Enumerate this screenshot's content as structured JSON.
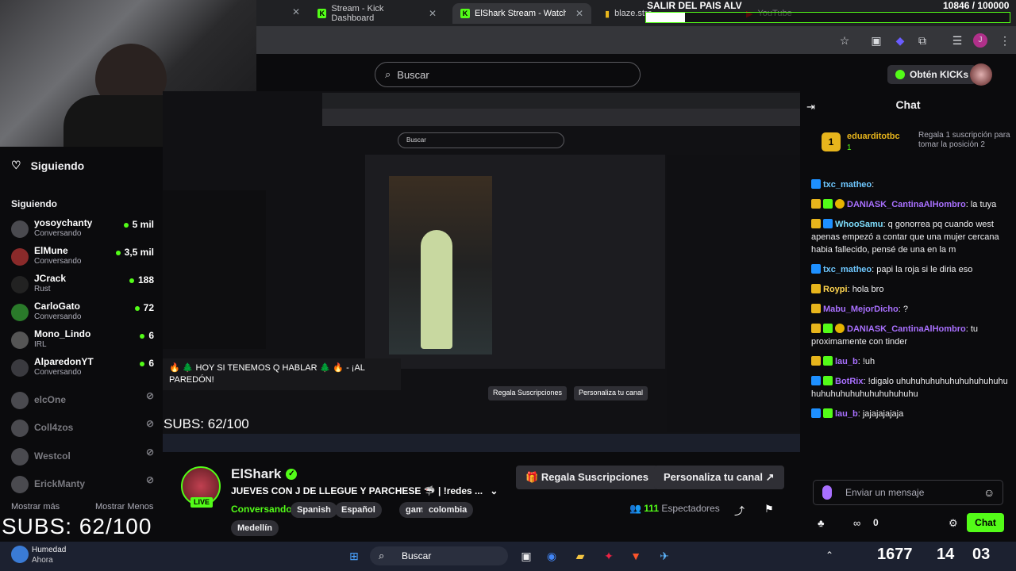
{
  "browser": {
    "tabs": [
      {
        "label": "Stream - Kick Dashboard",
        "active": false
      },
      {
        "label": "ElShark Stream - Watch Live",
        "active": true
      },
      {
        "label": "blaze.stream/blaze",
        "active": false
      },
      {
        "label": "YouTube",
        "active": false
      }
    ]
  },
  "overlay": {
    "goal_title": "SALIR DEL PAIS ALV",
    "goal_count": "10846 / 100000",
    "goal_fraction": 0.108,
    "subs_goal": "SUBS: 62/100"
  },
  "notification": {
    "text": "🔥 🌲 HOY SI TENEMOS Q HABLAR 🌲 🔥 - ¡AL PAREDÓN!"
  },
  "header": {
    "search_placeholder": "Buscar",
    "kicks_button": "Obtén KICKs"
  },
  "sidebar": {
    "section_title": "Siguiendo",
    "subheading": "Siguiendo",
    "channels": [
      {
        "name": "yosoychanty",
        "category": "Conversando",
        "viewers": "5 mil",
        "live": true
      },
      {
        "name": "ElMune",
        "category": "Conversando",
        "viewers": "3,5 mil",
        "live": true
      },
      {
        "name": "JCrack",
        "category": "Rust",
        "viewers": "188",
        "live": true
      },
      {
        "name": "CarloGato",
        "category": "Conversando",
        "viewers": "72",
        "live": true
      },
      {
        "name": "Mono_Lindo",
        "category": "IRL",
        "viewers": "6",
        "live": true
      },
      {
        "name": "AlparedonYT",
        "category": "Conversando",
        "viewers": "6",
        "live": true
      },
      {
        "name": "elcOne",
        "category": "",
        "viewers": "",
        "live": false
      },
      {
        "name": "Coll4zos",
        "category": "",
        "viewers": "",
        "live": false
      },
      {
        "name": "Westcol",
        "category": "",
        "viewers": "",
        "live": false
      },
      {
        "name": "ErickManty",
        "category": "",
        "viewers": "",
        "live": false
      }
    ],
    "show_more": "Mostrar más",
    "show_less": "Mostrar Menos"
  },
  "stream": {
    "streamer": "ElShark",
    "live_label": "LIVE",
    "title": "JUEVES CON J DE LLEGUE Y PARCHESE 🦈 | !redes ...",
    "category": "Conversando",
    "tags": [
      "Spanish",
      "Español",
      "gaming",
      "colombia",
      "Medellín"
    ],
    "gift_button": "Regala Suscripciones",
    "customize_button": "Personaliza tu canal",
    "viewers_count": "111",
    "viewers_label": "Espectadores"
  },
  "chat": {
    "title": "Chat",
    "pinned": {
      "rank": "1",
      "user": "eduarditotbc",
      "level": "1",
      "text": "Regala 1 suscripción para tomar la posición 2"
    },
    "messages": [
      {
        "user": "txc_matheo",
        "color": "u-blue",
        "text": ""
      },
      {
        "user": "DANIASK_CantinaAlHombro",
        "color": "u-purple",
        "text": "la tuya"
      },
      {
        "user": "WhooSamu",
        "color": "u-teal",
        "text": "q gonorrea pq cuando west apenas empezó a contar que una mujer cercana habia fallecido, pensé de una en la m"
      },
      {
        "user": "txc_matheo",
        "color": "u-blue",
        "text": "papi la roja si le diria eso"
      },
      {
        "user": "Roypi",
        "color": "u-yellow",
        "text": "hola bro"
      },
      {
        "user": "Mabu_MejorDicho",
        "color": "u-purple",
        "text": "?"
      },
      {
        "user": "DANIASK_CantinaAlHombro",
        "color": "u-purple",
        "text": "tu proximamente con tinder"
      },
      {
        "user": "lau_b",
        "color": "u-purple",
        "text": "!uh"
      },
      {
        "user": "BotRix",
        "color": "u-purple",
        "text": "!digalo uhuhuhuhuhuhuhuhuhuhuhuhuhuhuhuhuhuhuhuhuhuhu"
      },
      {
        "user": "lau_b",
        "color": "u-purple",
        "text": "jajajajajaja"
      }
    ],
    "input_placeholder": "Enviar un mensaje",
    "points": "0",
    "send_button": "Chat"
  },
  "taskbar": {
    "notification_title": "Humedad",
    "notification_sub": "Ahora",
    "search": "Buscar",
    "tray_left": "1677",
    "time": "14",
    "seconds": "03"
  },
  "colors": {
    "accent": "#53fc18",
    "purple": "#a970ff",
    "gold": "#e7b51c"
  }
}
